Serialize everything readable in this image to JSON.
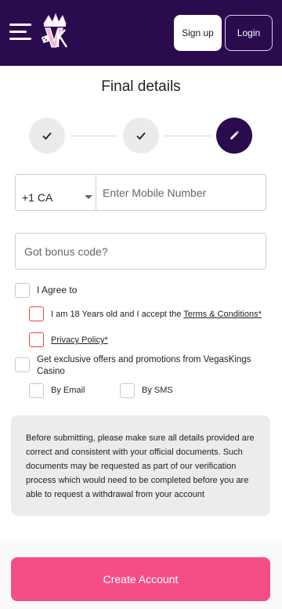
{
  "header": {
    "menu_icon": "hamburger-icon",
    "logo_icon": "vegaskings-logo",
    "signup_label": "Sign up",
    "login_label": "Login",
    "bg_color": "#2a0b4e"
  },
  "page": {
    "title": "Final details"
  },
  "stepper": {
    "steps": [
      {
        "state": "completed",
        "icon": "check-icon"
      },
      {
        "state": "completed",
        "icon": "check-icon"
      },
      {
        "state": "current",
        "icon": "pencil-icon"
      }
    ]
  },
  "form": {
    "country_code": "+1 CA",
    "mobile_placeholder": "Enter Mobile Number",
    "bonus_placeholder": "Got bonus code?",
    "agree_label": "I Agree to",
    "age_terms_prefix": "I am 18 Years old and I accept the ",
    "terms_link": "Terms & Conditions*",
    "privacy_link": "Privacy Policy*",
    "offers_label": "Get exclusive offers and promotions from VegasKings Casino",
    "by_email_label": "By Email",
    "by_sms_label": "By SMS"
  },
  "notice": {
    "text": "Before submitting, please make sure all details provided are correct and consistent with your official documents. Such documents may be requested as part of our verification process which would need to be completed before you are able to request a withdrawal from your account"
  },
  "footer": {
    "create_label": "Create Account",
    "accent_color": "#f54e87"
  }
}
